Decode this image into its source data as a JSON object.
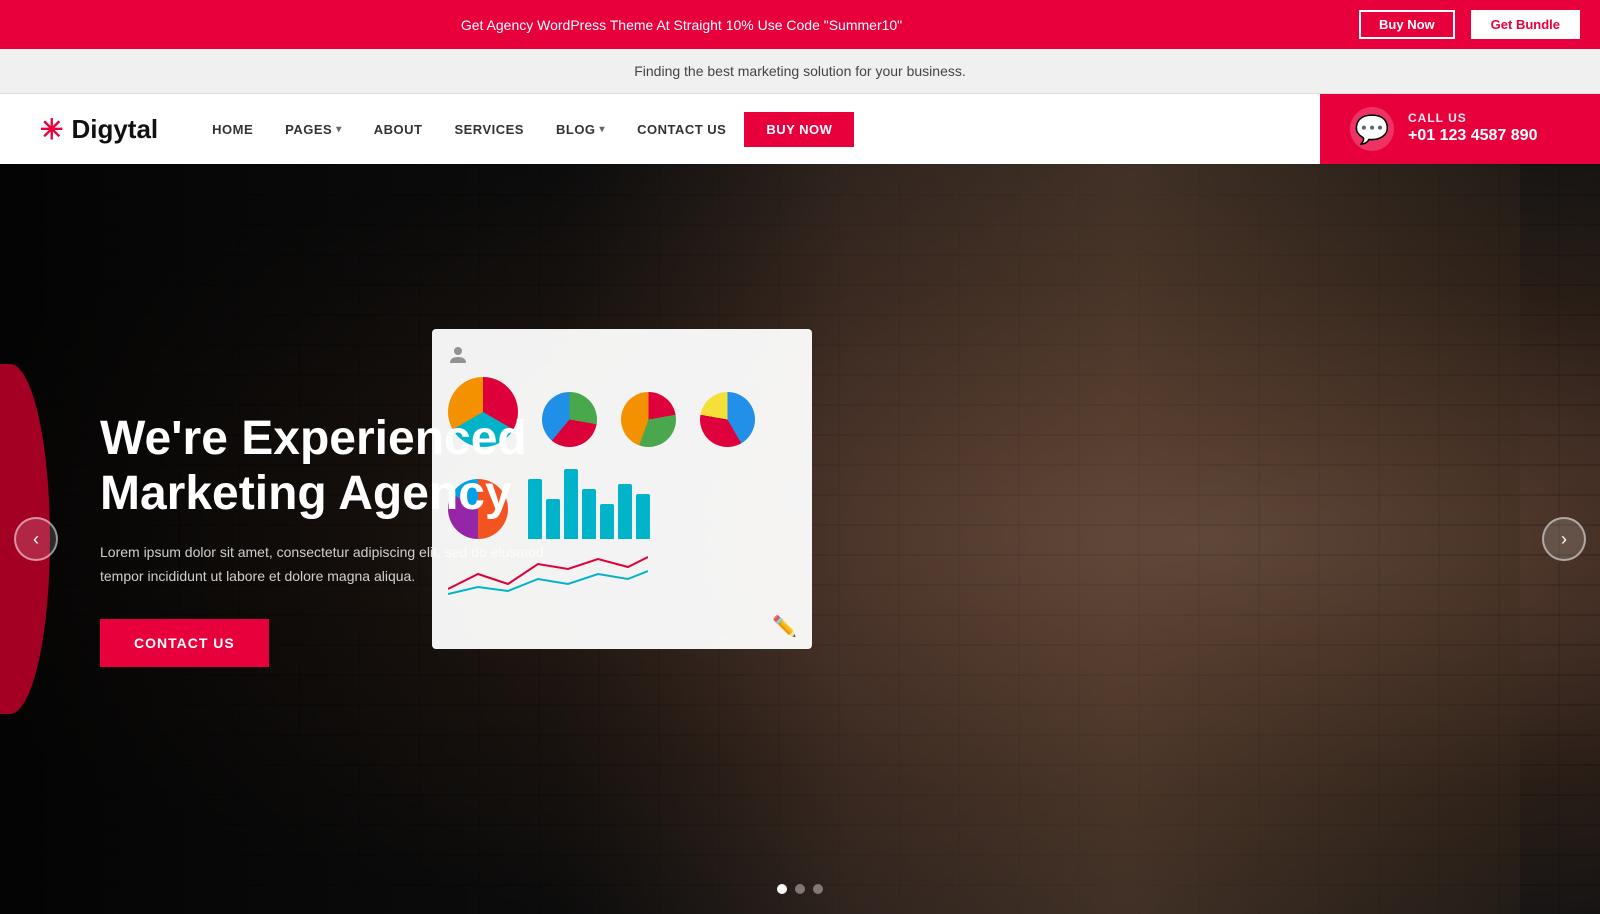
{
  "announcement": {
    "text": "Get Agency WordPress Theme At Straight 10% Use Code \"Summer10\"",
    "buy_now": "Buy Now",
    "get_bundle": "Get Bundle"
  },
  "sub_announcement": {
    "text": "Finding the best marketing solution for your business."
  },
  "header": {
    "logo_text": "Digytal",
    "nav": [
      {
        "label": "HOME",
        "has_dropdown": false
      },
      {
        "label": "PAGES",
        "has_dropdown": true
      },
      {
        "label": "ABOUT",
        "has_dropdown": false
      },
      {
        "label": "SERVICES",
        "has_dropdown": false
      },
      {
        "label": "BLOG",
        "has_dropdown": true
      },
      {
        "label": "CONTACT US",
        "has_dropdown": false
      }
    ],
    "buy_now": "BUY NOW",
    "call_us": {
      "label": "CALL US",
      "number": "+01 123 4587 890"
    }
  },
  "hero": {
    "title": "We're Experienced Marketing Agency",
    "description": "Lorem ipsum dolor sit amet, consectetur adipiscing elit, sed do eiusmod tempor incididunt ut labore et dolore magna aliqua.",
    "cta_button": "CONTACT US",
    "carousel": {
      "prev_label": "‹",
      "next_label": "›",
      "dots": [
        true,
        false,
        false
      ]
    }
  }
}
